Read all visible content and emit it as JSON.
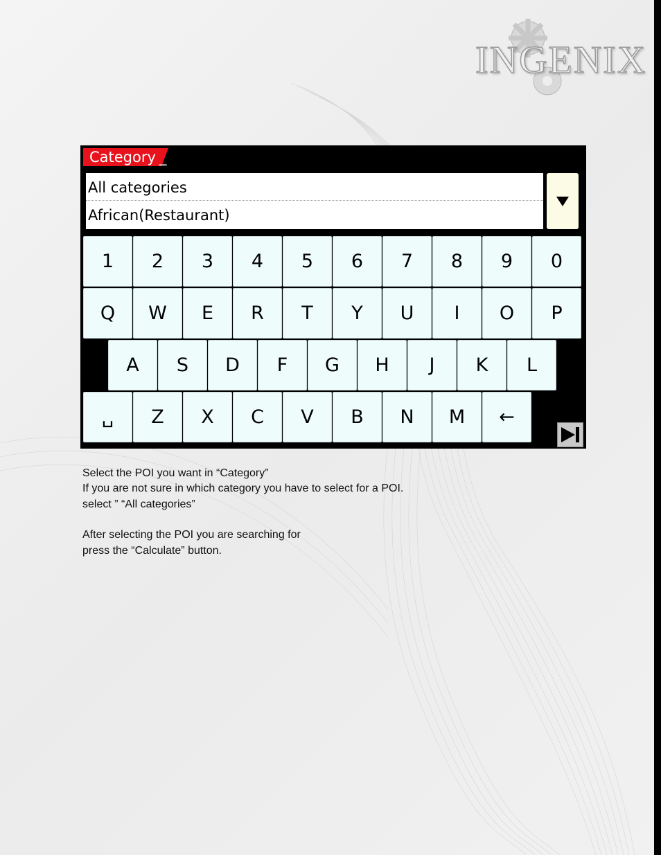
{
  "brand": {
    "logo_text": "INGENIX"
  },
  "device": {
    "field_label": "Category",
    "cursor": "_",
    "list_items": [
      "All categories",
      "African(Restaurant)"
    ],
    "keyboard": {
      "row1": [
        "1",
        "2",
        "3",
        "4",
        "5",
        "6",
        "7",
        "8",
        "9",
        "0"
      ],
      "row2": [
        "Q",
        "W",
        "E",
        "R",
        "T",
        "Y",
        "U",
        "I",
        "O",
        "P"
      ],
      "row3": [
        "A",
        "S",
        "D",
        "F",
        "G",
        "H",
        "J",
        "K",
        "L"
      ],
      "row4": [
        "␣",
        "Z",
        "X",
        "C",
        "V",
        "B",
        "N",
        "M",
        "←"
      ]
    },
    "icons": {
      "dropdown": "triangle-down-icon",
      "next": "skip-forward-icon"
    }
  },
  "instructions": {
    "line1": "Select the POI you want in “Category”",
    "line2": "If you are not sure in which category you have to select for a POI.",
    "line3": "select ” “All categories”",
    "line4": "After selecting the POI you are searching for",
    "line5": "press the “Calculate” button."
  },
  "colors": {
    "accent": "#e8121d",
    "key_bg": "#eefcfb",
    "dropdown_bg": "#fbfbe6"
  }
}
